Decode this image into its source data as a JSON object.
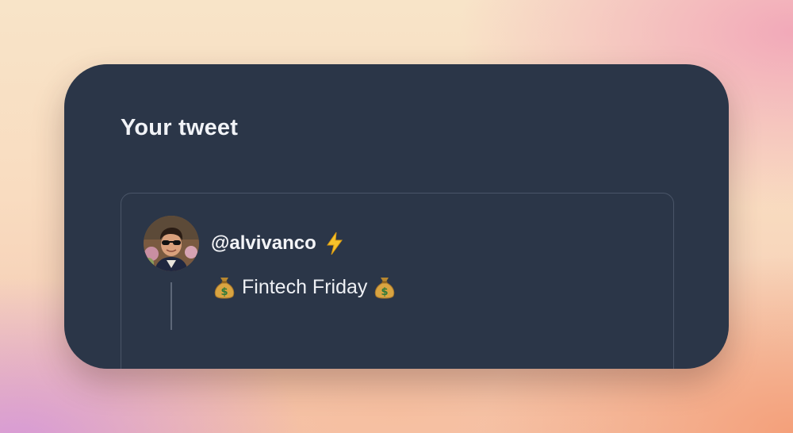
{
  "card": {
    "title": "Your tweet"
  },
  "tweet": {
    "handle": "@alvivanco",
    "handle_icon": "lightning-bolt-icon",
    "text": "Fintech Friday",
    "text_prefix_icon": "money-bag-icon",
    "text_suffix_icon": "money-bag-icon",
    "avatar_icon": "avatar"
  },
  "colors": {
    "card_background": "#2b3648",
    "border": "#4a5568",
    "text": "#f1f3f7",
    "bolt": "#f5c22b"
  }
}
